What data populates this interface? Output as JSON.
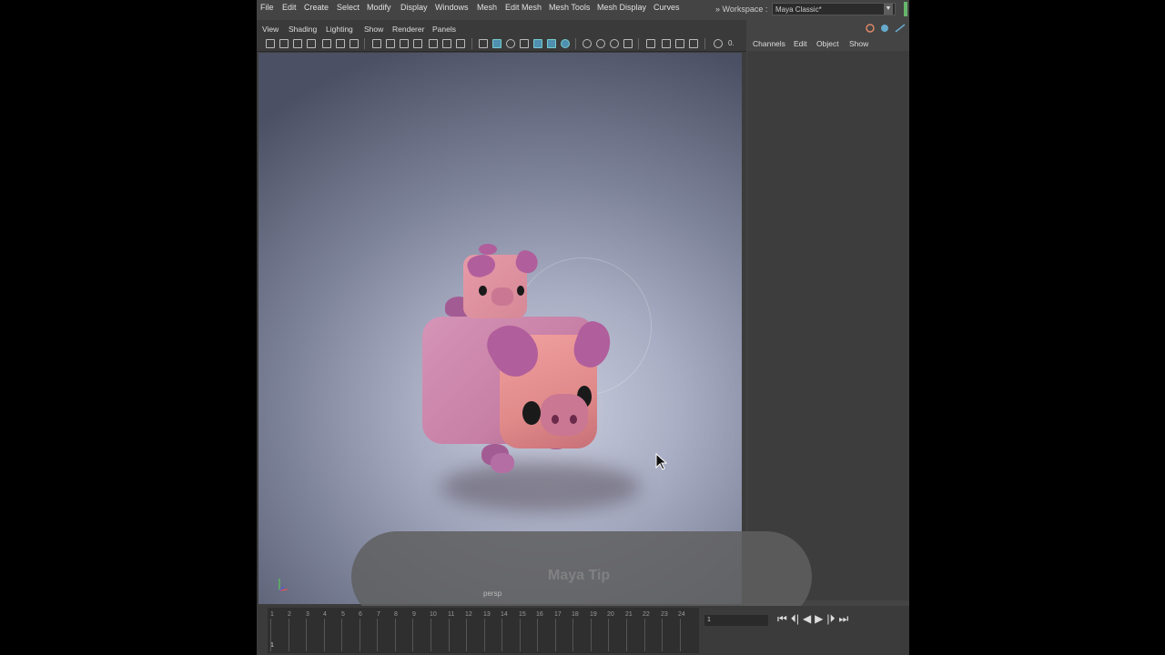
{
  "menu": [
    "File",
    "Edit",
    "Create",
    "Select",
    "Modify",
    "Display",
    "Windows",
    "Mesh",
    "Edit Mesh",
    "Mesh Tools",
    "Mesh Display",
    "Curves"
  ],
  "workspace": {
    "label": "Workspace :",
    "value": "Maya Classic*"
  },
  "viewport_menu": [
    "View",
    "Shading",
    "Lighting",
    "Show",
    "Renderer",
    "Panels"
  ],
  "viewport": {
    "camera_label": "persp",
    "toolbar_value": "0."
  },
  "channel_box_menu": [
    "Channels",
    "Edit",
    "Object",
    "Show"
  ],
  "overlay": {
    "text": "Maya Tip"
  },
  "timeline": {
    "frames": [
      "1",
      "2",
      "3",
      "4",
      "5",
      "6",
      "7",
      "8",
      "9",
      "10",
      "11",
      "12",
      "13",
      "14",
      "15",
      "16",
      "17",
      "18",
      "19",
      "20",
      "21",
      "22",
      "23",
      "24"
    ],
    "current_frame": "1",
    "start_frame_field": "1"
  },
  "colors": {
    "accent": "#4f8fb0",
    "workspace_indicator": "#66b66a",
    "pig_body": "#c77fa5",
    "pig_face": "#e08a8a"
  }
}
